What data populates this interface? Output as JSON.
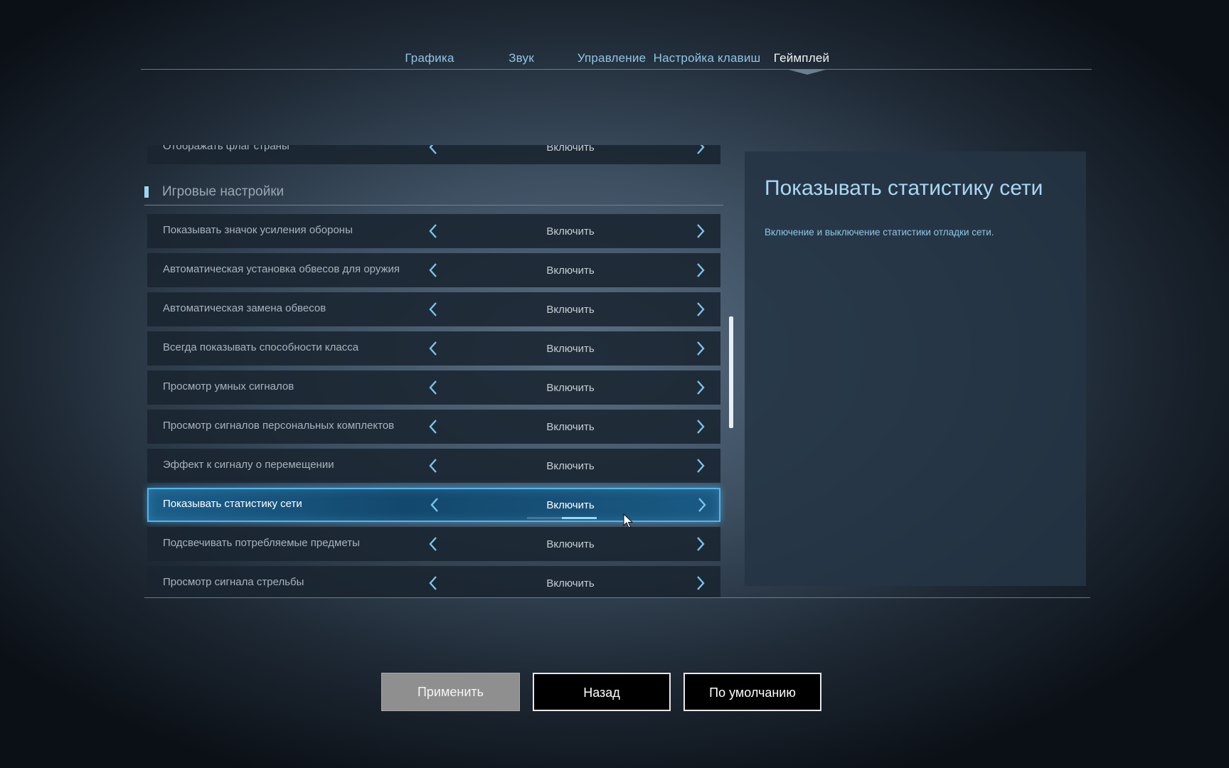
{
  "tabs": [
    {
      "label": "Графика",
      "active": false
    },
    {
      "label": "Звук",
      "active": false
    },
    {
      "label": "Управление",
      "active": false
    },
    {
      "label": "Настройка клавиш",
      "active": false
    },
    {
      "label": "Геймплей",
      "active": true
    }
  ],
  "list": {
    "partial_row": {
      "label": "Отображать флаг страны",
      "value": "Включить"
    },
    "section_title": "Игровые настройки",
    "rows": [
      {
        "label": "Показывать значок усиления обороны",
        "value": "Включить"
      },
      {
        "label": "Автоматическая установка обвесов для оружия",
        "value": "Включить"
      },
      {
        "label": "Автоматическая замена обвесов",
        "value": "Включить"
      },
      {
        "label": "Всегда показывать способности класса",
        "value": "Включить"
      },
      {
        "label": "Просмотр умных сигналов",
        "value": "Включить"
      },
      {
        "label": "Просмотр сигналов персональных комплектов",
        "value": "Включить"
      },
      {
        "label": "Эффект к сигналу о перемещении",
        "value": "Включить"
      },
      {
        "label": "Показывать статистику сети",
        "value": "Включить",
        "selected": true,
        "option_position": 0.5
      },
      {
        "label": "Подсвечивать потребляемые предметы",
        "value": "Включить"
      },
      {
        "label": "Просмотр сигнала стрельбы",
        "value": "Включить"
      }
    ]
  },
  "description": {
    "title": "Показывать статистику сети",
    "text": "Включение и выключение статистики отладки сети."
  },
  "buttons": {
    "apply": "Применить",
    "back": "Назад",
    "defaults": "По умолчанию"
  },
  "icons": {
    "arrow_left": "chevron-left-icon",
    "arrow_right": "chevron-right-icon",
    "cursor": "mouse-pointer-icon"
  },
  "colors": {
    "accent": "#4fb6ee",
    "tab_inactive": "#8dc6e6",
    "tab_active": "#f2f5f7",
    "apply_bg": "#8f8f8f",
    "button_bg": "#000000"
  }
}
